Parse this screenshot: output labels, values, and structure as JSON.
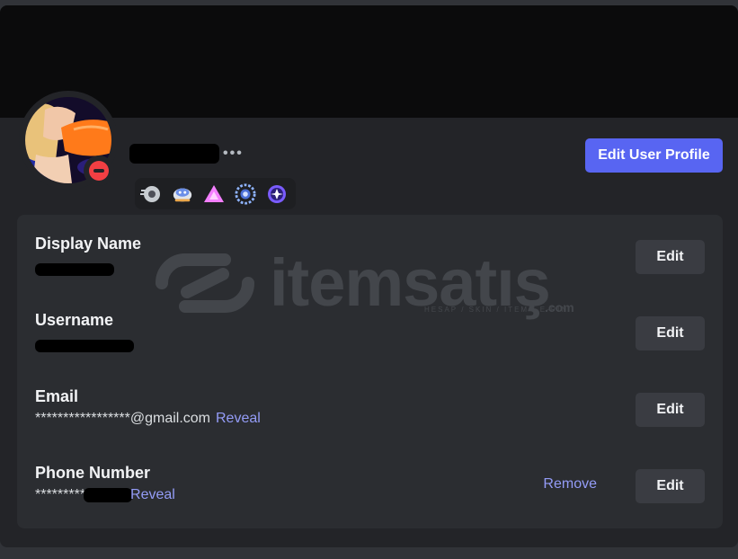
{
  "profile": {
    "edit_profile_label": "Edit User Profile",
    "more_label": "•••",
    "badges": [
      "hypesquad-icon",
      "quest-icon",
      "nitro-triangle-icon",
      "laurel-icon",
      "orb-icon"
    ],
    "status": "do-not-disturb"
  },
  "account": {
    "display_name": {
      "label": "Display Name",
      "edit_label": "Edit"
    },
    "username": {
      "label": "Username",
      "edit_label": "Edit"
    },
    "email": {
      "label": "Email",
      "value": "*****************@gmail.com",
      "reveal_label": "Reveal",
      "edit_label": "Edit"
    },
    "phone": {
      "label": "Phone Number",
      "value": "*********",
      "reveal_label": "Reveal",
      "remove_label": "Remove",
      "edit_label": "Edit"
    }
  },
  "watermark": {
    "text": "itemsatış",
    "subtext": "HESAP / SKIN / ITEM / E-PIN",
    "suffix": ".com"
  },
  "colors": {
    "accent": "#5865f2",
    "link": "#949cf7",
    "dnd": "#f23f43",
    "panel": "#2b2d31",
    "card": "#232428"
  }
}
